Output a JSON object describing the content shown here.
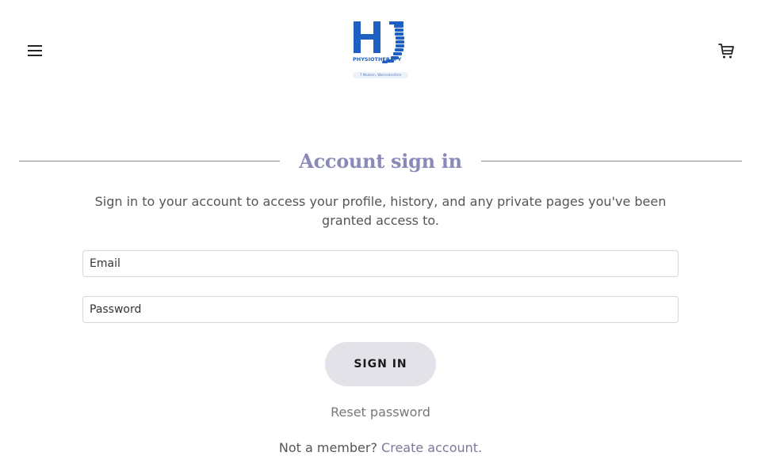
{
  "header": {
    "menu_icon": "hamburger-menu-icon",
    "cart_icon": "shopping-cart-icon",
    "logo": {
      "letters": "HJ",
      "text": "PHYSIOTHERAPY",
      "subtitle": "7 Malvern, Worcestershire"
    }
  },
  "main": {
    "title": "Account sign in",
    "description": "Sign in to your account to access your profile, history, and any private pages you've been granted access to.",
    "email_placeholder": "Email",
    "password_placeholder": "Password",
    "sign_in_label": "SIGN IN",
    "reset_label": "Reset password",
    "not_member_label": "Not a member?",
    "create_account_label": "Create account."
  },
  "colors": {
    "title": "#8a8ab8",
    "button_bg": "#e2e2e8",
    "logo_blue": "#1e5fc2"
  }
}
